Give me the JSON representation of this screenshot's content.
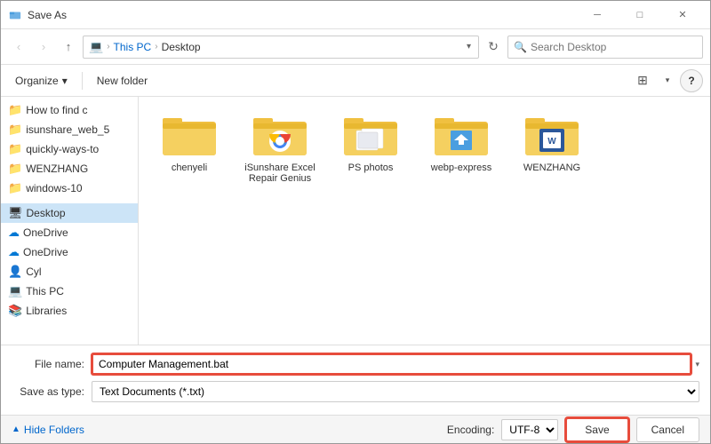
{
  "window": {
    "title": "Save As",
    "close_label": "✕",
    "minimize_label": "─",
    "maximize_label": "□"
  },
  "addressbar": {
    "back_title": "Back",
    "forward_title": "Forward",
    "up_title": "Up",
    "path_parts": [
      "This PC",
      "Desktop"
    ],
    "search_placeholder": "Search Desktop",
    "refresh_title": "Refresh"
  },
  "toolbar": {
    "organize_label": "Organize",
    "organize_arrow": "▾",
    "new_folder_label": "New folder",
    "view_icon": "⊞",
    "view_arrow": "▾",
    "help_label": "?"
  },
  "sidebar": {
    "items": [
      {
        "id": "how-to-find",
        "label": "How to find c",
        "icon": "📁"
      },
      {
        "id": "isunshare-web",
        "label": "isunshare_web_5",
        "icon": "📁"
      },
      {
        "id": "quickly-ways",
        "label": "quickly-ways-to",
        "icon": "📁"
      },
      {
        "id": "wenzhang",
        "label": "WENZHANG",
        "icon": "📁"
      },
      {
        "id": "windows-10",
        "label": "windows-10",
        "icon": "📁"
      },
      {
        "id": "desktop",
        "label": "Desktop",
        "icon": "🖥"
      },
      {
        "id": "onedrive1",
        "label": "OneDrive",
        "icon": "☁"
      },
      {
        "id": "onedrive2",
        "label": "OneDrive",
        "icon": "☁"
      },
      {
        "id": "cyl",
        "label": "Cyl",
        "icon": "👤"
      },
      {
        "id": "this-pc",
        "label": "This PC",
        "icon": "💻"
      },
      {
        "id": "libraries",
        "label": "Libraries",
        "icon": "📚"
      }
    ]
  },
  "content": {
    "folders": [
      {
        "id": "chenyeli",
        "label": "chenyeli",
        "type": "folder-plain"
      },
      {
        "id": "isunshare-excel",
        "label": "iSunshare Excel Repair Genius",
        "type": "folder-chrome"
      },
      {
        "id": "ps-photos",
        "label": "PS photos",
        "type": "folder-plain"
      },
      {
        "id": "webp-express",
        "label": "webp-express",
        "type": "folder-blue"
      },
      {
        "id": "wenzhang",
        "label": "WENZHANG",
        "type": "folder-word"
      }
    ]
  },
  "form": {
    "filename_label": "File name:",
    "filename_value": "Computer Management.bat",
    "savetype_label": "Save as type:",
    "savetype_value": "Text Documents (*.txt)",
    "filename_placeholder": "Computer Management.bat"
  },
  "statusbar": {
    "hide_folders_label": "Hide Folders",
    "encoding_label": "Encoding:",
    "encoding_value": "UTF-8",
    "save_label": "Save",
    "cancel_label": "Cancel"
  }
}
